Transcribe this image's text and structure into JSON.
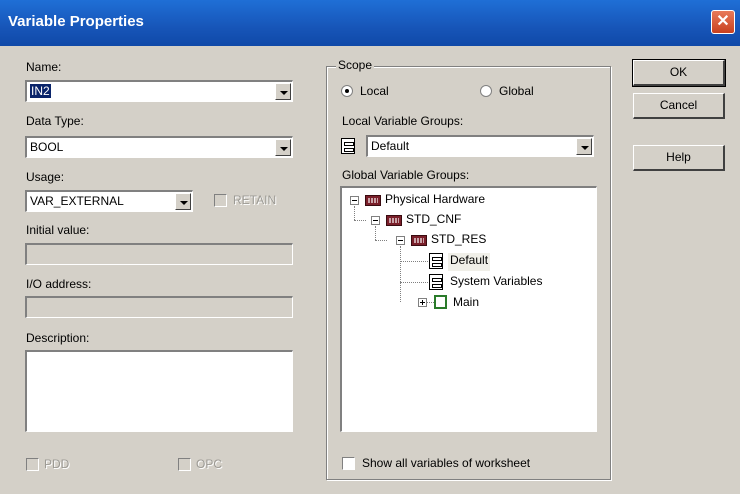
{
  "window": {
    "title": "Variable Properties",
    "close_glyph": "✕"
  },
  "left": {
    "name_label": "Name:",
    "name_value": "IN2",
    "datatype_label": "Data Type:",
    "datatype_value": "BOOL",
    "usage_label": "Usage:",
    "usage_value": "VAR_EXTERNAL",
    "retain_label": "RETAIN",
    "initial_label": "Initial value:",
    "initial_value": "",
    "io_label": "I/O address:",
    "io_value": "",
    "description_label": "Description:",
    "description_value": "",
    "pdd_label": "PDD",
    "opc_label": "OPC"
  },
  "scope": {
    "group_label": "Scope",
    "local_label": "Local",
    "global_label": "Global",
    "selected": "Local",
    "local_groups_label": "Local Variable Groups:",
    "local_groups_value": "Default",
    "global_groups_label": "Global Variable Groups:",
    "tree": [
      {
        "label": "Physical Hardware",
        "icon": "hardware-icon"
      },
      {
        "label": "STD_CNF",
        "icon": "hardware-icon"
      },
      {
        "label": "STD_RES",
        "icon": "hardware-icon"
      },
      {
        "label": "Default",
        "icon": "cabinet-icon"
      },
      {
        "label": "System Variables",
        "icon": "cabinet-icon"
      },
      {
        "label": "Main",
        "icon": "program-icon"
      }
    ],
    "show_all_label": "Show all variables of worksheet"
  },
  "buttons": {
    "ok": "OK",
    "cancel": "Cancel",
    "help": "Help"
  }
}
